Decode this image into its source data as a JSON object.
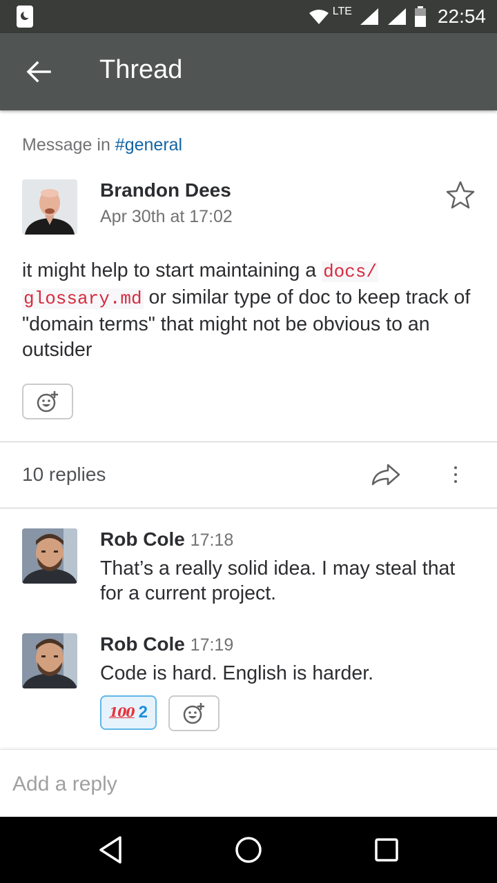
{
  "status_bar": {
    "network": "LTE",
    "time": "22:54"
  },
  "app_bar": {
    "title": "Thread"
  },
  "context": {
    "prefix": "Message in ",
    "channel": "#general"
  },
  "parent_message": {
    "author": "Brandon Dees",
    "timestamp": "Apr 30th at 17:02",
    "text_part1": "it might help to start maintaining a ",
    "code1": "docs/",
    "code2": "glossary.md",
    "text_part2": " or similar type of doc to keep track of \"domain terms\" that might not be obvious to an outsider"
  },
  "thread_bar": {
    "replies": "10 replies"
  },
  "replies": [
    {
      "author": "Rob Cole",
      "time": "17:18",
      "text": "That’s a really solid idea. I may steal that for a current project."
    },
    {
      "author": "Rob Cole",
      "time": "17:19",
      "text": "Code is hard. English is harder.",
      "reaction_emoji": "100",
      "reaction_count": "2"
    }
  ],
  "composer": {
    "placeholder": "Add a reply"
  },
  "icons": [
    "back-arrow-icon",
    "star-icon",
    "add-reaction-icon",
    "share-icon",
    "more-vertical-icon",
    "nav-back-icon",
    "nav-home-icon",
    "nav-recents-icon"
  ],
  "colors": {
    "app_bar": "#505553",
    "link": "#1264a3",
    "code": "#d72b3f",
    "reaction_border": "#5fb7e8"
  }
}
